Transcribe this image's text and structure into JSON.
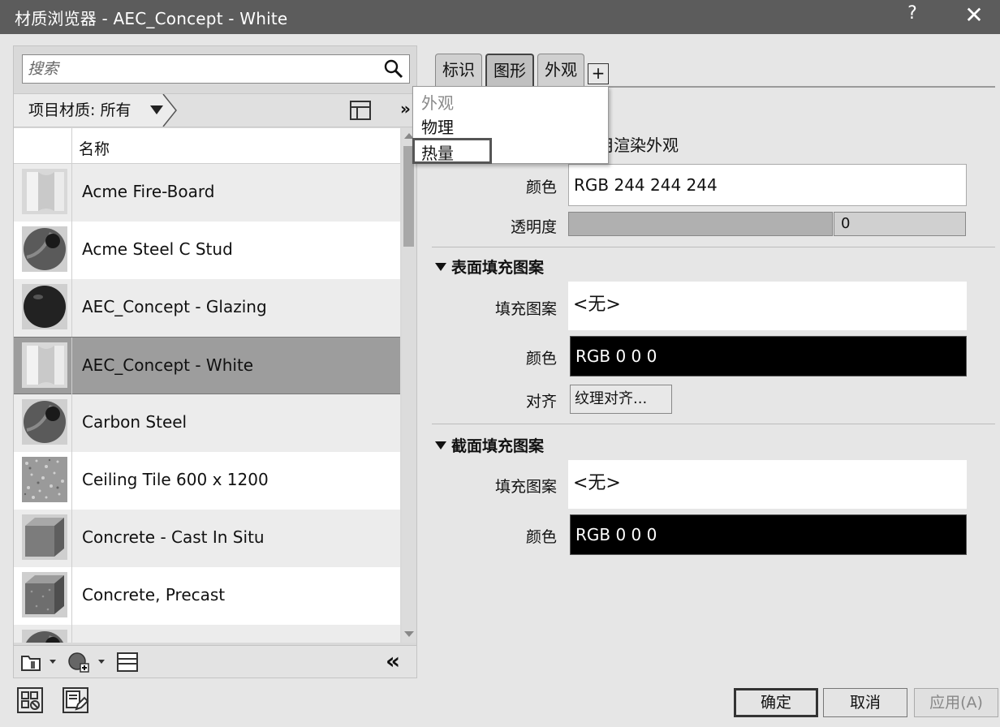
{
  "window": {
    "title": "材质浏览器 - AEC_Concept - White",
    "help_label": "?",
    "close_label": "✕"
  },
  "browser": {
    "search": {
      "placeholder": "搜索",
      "value": ""
    },
    "filter_label": "项目材质: 所有",
    "more_label": "»",
    "column_name": "名称",
    "materials": [
      {
        "name": "Acme Fire-Board",
        "thumb": "panel"
      },
      {
        "name": "Acme Steel C Stud",
        "thumb": "sphere-dark-hole"
      },
      {
        "name": "AEC_Concept - Glazing",
        "thumb": "sphere-black"
      },
      {
        "name": "AEC_Concept - White",
        "thumb": "panel",
        "selected": true
      },
      {
        "name": "Carbon Steel",
        "thumb": "sphere-dark-hole"
      },
      {
        "name": "Ceiling Tile 600 x 1200",
        "thumb": "speckle"
      },
      {
        "name": "Concrete - Cast In Situ",
        "thumb": "cube"
      },
      {
        "name": "Concrete, Precast",
        "thumb": "cube-rough"
      },
      {
        "name": "",
        "thumb": "sphere-dark-hole"
      }
    ],
    "collapse_label": "«"
  },
  "tabs": [
    {
      "label": "标识"
    },
    {
      "label": "图形",
      "active": true
    },
    {
      "label": "外观"
    }
  ],
  "add_tab_label": "+",
  "menu": {
    "items": [
      {
        "label": "外观",
        "disabled": true
      },
      {
        "label": "物理"
      },
      {
        "label": "热量",
        "highlighted": true
      }
    ]
  },
  "graphics": {
    "render_appearance_label": "用渲染外观",
    "shading": {
      "color_label": "颜色",
      "color_value": "RGB 244 244 244",
      "transparency_label": "透明度",
      "transparency_value": "0"
    },
    "surface_pattern": {
      "header": "表面填充图案",
      "pattern_label": "填充图案",
      "pattern_value": "<无>",
      "color_label": "颜色",
      "color_value": "RGB 0 0 0",
      "align_label": "对齐",
      "align_button": "纹理对齐..."
    },
    "cut_pattern": {
      "header": "截面填充图案",
      "pattern_label": "填充图案",
      "pattern_value": "<无>",
      "color_label": "颜色",
      "color_value": "RGB 0 0 0"
    }
  },
  "buttons": {
    "ok": "确定",
    "cancel": "取消",
    "apply": "应用(A)"
  }
}
